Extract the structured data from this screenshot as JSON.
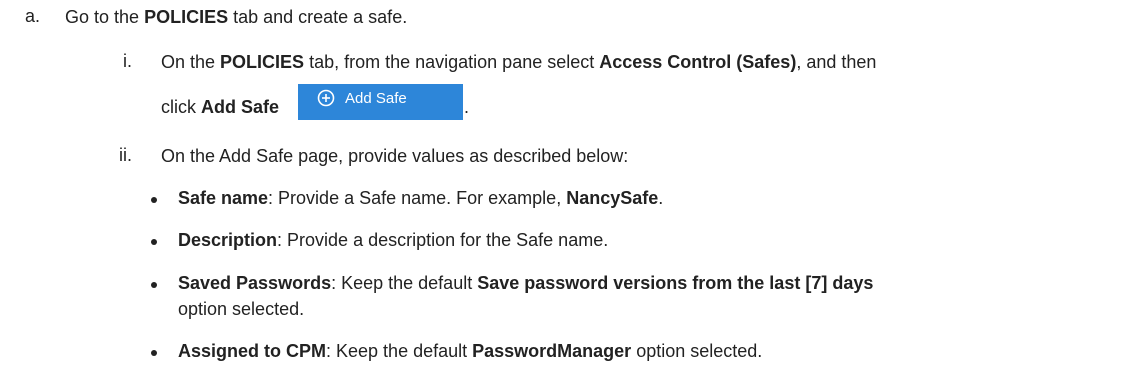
{
  "steps": {
    "a": {
      "marker": "a.",
      "t1": "Go to the ",
      "b1": "POLICIES",
      "t2": " tab and create a safe."
    },
    "i": {
      "marker": "i.",
      "t1": "On the ",
      "b1": "POLICIES",
      "t2": " tab, from the navigation pane select ",
      "b2": "Access Control (Safes)",
      "t3": ", and then",
      "t4": "click ",
      "b3": "Add Safe",
      "t5": ".",
      "button_label": "Add Safe",
      "button_icon": "plus-circle-icon"
    },
    "ii": {
      "marker": "ii.",
      "t1": "On the Add Safe page, provide values as described below:"
    }
  },
  "bullets": [
    {
      "b1": "Safe name",
      "t1": ": Provide a Safe name. For example, ",
      "b2": "NancySafe",
      "t2": "."
    },
    {
      "b1": "Description",
      "t1": ": Provide a description for the Safe name."
    },
    {
      "b1": "Saved Passwords",
      "t1": ": Keep the default ",
      "b2": "Save password versions from the last [7] days",
      "t2": "option selected."
    },
    {
      "b1": "Assigned to CPM",
      "t1": ": Keep the default ",
      "b2": "PasswordManager",
      "t2": " option selected."
    }
  ],
  "colors": {
    "text": "#222222",
    "button": "#2d86d9",
    "button_text": "#ffffff"
  }
}
